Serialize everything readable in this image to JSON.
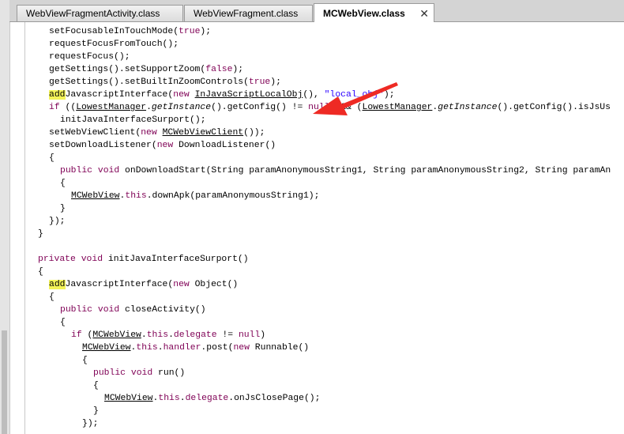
{
  "tabs": [
    {
      "label": "WebViewFragmentActivity.class"
    },
    {
      "label": "WebViewFragment.class"
    },
    {
      "label": "MCWebView.class",
      "close": "✕"
    }
  ],
  "code": {
    "l1": "setFocusableInTouchMode(",
    "l1_true": "true",
    "l1_end": ");",
    "l2": "requestFocusFromTouch();",
    "l3": "requestFocus();",
    "l4": "getSettings().setSupportZoom(",
    "l4_false": "false",
    "l4_end": ");",
    "l5": "getSettings().setBuiltInZoomControls(",
    "l5_true": "true",
    "l5_end": ");",
    "l6_add": "add",
    "l6_mid": "JavascriptInterface(",
    "l6_new": "new",
    "l6_sp": " ",
    "l6_cls": "InJavaScriptLocalObj",
    "l6_paren": "(), ",
    "l6_str": "\"local_obj\"",
    "l6_end": ");",
    "l7_if": "if",
    "l7_a": " ((",
    "l7_lm1": "LowestManager",
    "l7_b": ".",
    "l7_gi1": "getInstance",
    "l7_c": "().getConfig() != ",
    "l7_null": "null",
    "l7_d": ") && (",
    "l7_lm2": "LowestManager",
    "l7_e": ".",
    "l7_gi2": "getInstance",
    "l7_f": "().getConfig().isJsUs",
    "l8": "initJavaInterfaceSurport();",
    "l9_a": "setWebViewClient(",
    "l9_new": "new",
    "l9_sp": " ",
    "l9_cls": "MCWebViewClient",
    "l9_end": "());",
    "l10_a": "setDownloadListener(",
    "l10_new": "new",
    "l10_end": " DownloadListener()",
    "l11": "{",
    "l12_pub": "public",
    "l12_sp": " ",
    "l12_void": "void",
    "l12_rest": " onDownloadStart(String paramAnonymousString1, String paramAnonymousString2, String paramAn",
    "l13": "{",
    "l14_cls": "MCWebView",
    "l14_dot": ".",
    "l14_this": "this",
    "l14_rest": ".downApk(paramAnonymousString1);",
    "l15": "}",
    "l16": "});",
    "l17": "}",
    "l19_priv": "private",
    "l19_sp": " ",
    "l19_void": "void",
    "l19_rest": " initJavaInterfaceSurport()",
    "l20": "{",
    "l21_add": "add",
    "l21_mid": "JavascriptInterface(",
    "l21_new": "new",
    "l21_end": " Object()",
    "l22": "{",
    "l23_pub": "public",
    "l23_sp": " ",
    "l23_void": "void",
    "l23_rest": " closeActivity()",
    "l24": "{",
    "l25_if": "if",
    "l25_a": " (",
    "l25_cls": "MCWebView",
    "l25_dot": ".",
    "l25_this": "this",
    "l25_dot2": ".",
    "l25_del": "delegate",
    "l25_b": " != ",
    "l25_null": "null",
    "l25_c": ")",
    "l26_cls": "MCWebView",
    "l26_dot": ".",
    "l26_this": "this",
    "l26_dot2": ".",
    "l26_handler": "handler",
    "l26_a": ".post(",
    "l26_new": "new",
    "l26_b": " Runnable()",
    "l27": "{",
    "l28_pub": "public",
    "l28_sp": " ",
    "l28_void": "void",
    "l28_rest": " run()",
    "l29": "{",
    "l30_cls": "MCWebView",
    "l30_dot": ".",
    "l30_this": "this",
    "l30_dot2": ".",
    "l30_del": "delegate",
    "l30_rest": ".onJsClosePage();",
    "l31": "}",
    "l32": "});"
  },
  "colors": {
    "keyword": "#7f0055",
    "string": "#2a00ff",
    "highlight": "#f4f458",
    "arrow": "#ee2a24"
  }
}
